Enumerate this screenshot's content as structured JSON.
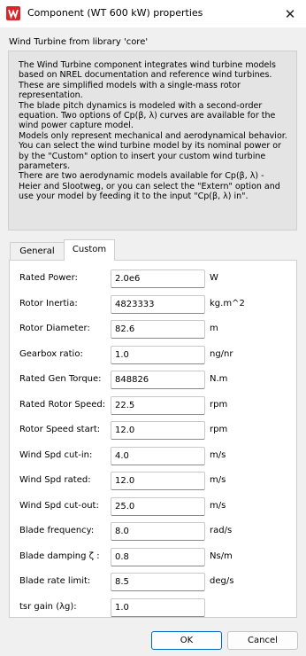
{
  "window": {
    "title": "Component (WT 600 kW) properties",
    "close_glyph": "✕",
    "app_icon": "app-logo-icon"
  },
  "subtitle": "Wind Turbine from library 'core'",
  "description_lines": [
    "The Wind Turbine component integrates wind turbine models",
    "based on NREL documentation and reference wind turbines.",
    "These are simplified models with a single-mass rotor",
    "representation.",
    "The blade pitch dynamics is modeled with a second-order",
    "equation. Two options of Cp(β, λ) curves are available for the",
    "wind power capture model.",
    "Models only represent mechanical and aerodynamical behavior.",
    "You can select the wind turbine model by its nominal power or",
    "by the \"Custom\" option to insert your custom wind turbine",
    "parameters.",
    "There are two aerodynamic models available for Cp(β, λ) -",
    "Heier and Slootweg, or you can select the \"Extern\" option and",
    "use your model by feeding it to the input \"Cp(β, λ) in\"."
  ],
  "tabs": [
    {
      "label": "General",
      "active": false
    },
    {
      "label": "Custom",
      "active": true
    }
  ],
  "params": [
    {
      "label": "Rated Power:",
      "value": "2.0e6",
      "unit": "W"
    },
    {
      "label": "Rotor Inertia:",
      "value": "4823333",
      "unit": "kg.m^2"
    },
    {
      "label": "Rotor Diameter:",
      "value": "82.6",
      "unit": "m"
    },
    {
      "label": "Gearbox ratio:",
      "value": "1.0",
      "unit": "ng/nr"
    },
    {
      "label": "Rated Gen Torque:",
      "value": "848826",
      "unit": "N.m"
    },
    {
      "label": "Rated Rotor Speed:",
      "value": "22.5",
      "unit": "rpm"
    },
    {
      "label": "Rotor Speed start:",
      "value": "12.0",
      "unit": "rpm"
    },
    {
      "label": "Wind Spd cut-in:",
      "value": "4.0",
      "unit": "m/s"
    },
    {
      "label": "Wind Spd rated:",
      "value": "12.0",
      "unit": "m/s"
    },
    {
      "label": "Wind Spd cut-out:",
      "value": "25.0",
      "unit": "m/s"
    },
    {
      "label": "Blade frequency:",
      "value": "8.0",
      "unit": "rad/s"
    },
    {
      "label": "Blade damping ζ :",
      "value": "0.8",
      "unit": "Ns/m"
    },
    {
      "label": "Blade rate limit:",
      "value": "8.5",
      "unit": "deg/s"
    },
    {
      "label": "tsr gain (λg):",
      "value": "1.0",
      "unit": ""
    }
  ],
  "buttons": {
    "ok": "OK",
    "cancel": "Cancel"
  }
}
